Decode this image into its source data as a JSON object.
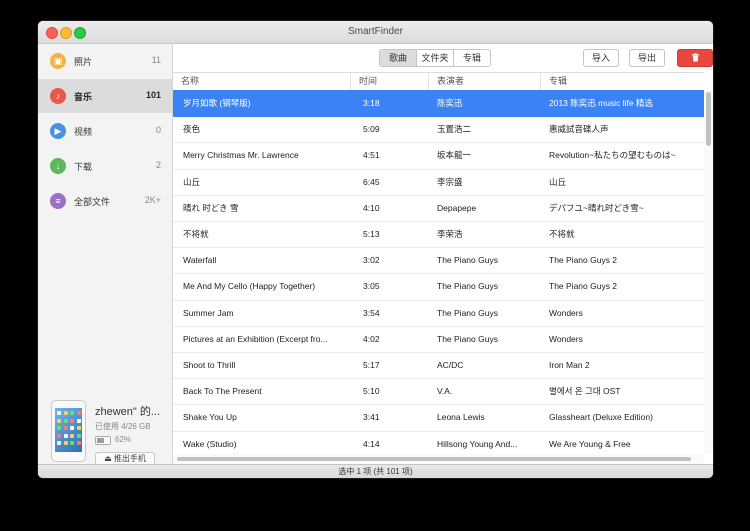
{
  "window": {
    "title": "SmartFinder"
  },
  "sidebar": {
    "items": [
      {
        "label": "照片",
        "count": "11",
        "icon": "photo-icon",
        "color": "#f5b33c",
        "glyph": "▣"
      },
      {
        "label": "音乐",
        "count": "101",
        "icon": "music-icon",
        "color": "#e8574c",
        "glyph": "♪",
        "active": true
      },
      {
        "label": "视频",
        "count": "0",
        "icon": "video-icon",
        "color": "#4a90e2",
        "glyph": "▶"
      },
      {
        "label": "下载",
        "count": "2",
        "icon": "download-icon",
        "color": "#5cb85c",
        "glyph": "↓"
      },
      {
        "label": "全部文件",
        "count": "2K+",
        "icon": "all-files-icon",
        "color": "#9b6fc7",
        "glyph": "≡"
      }
    ],
    "device": {
      "name": "zhewen\" 的...",
      "used": "已使用 4/26 GB",
      "battery": "62%",
      "battery_level": 0.62,
      "eject_label": "推出手机"
    }
  },
  "toolbar": {
    "tabs": [
      "歌曲",
      "文件夹",
      "专辑"
    ],
    "import_label": "导入",
    "export_label": "导出",
    "delete_icon": "trash-icon"
  },
  "table": {
    "columns": [
      "名称",
      "时间",
      "表演者",
      "专辑"
    ],
    "rows": [
      [
        "岁月如歌 (钢琴版)",
        "3:18",
        "陈奕迅",
        "2013 陈奕迅 music life 精选"
      ],
      [
        "夜色",
        "5:09",
        "玉置浩二",
        "惠威試音碟人声"
      ],
      [
        "Merry Christmas Mr. Lawrence",
        "4:51",
        "坂本龍一",
        "Revolution~私たちの望むものは~"
      ],
      [
        "山丘",
        "6:45",
        "李宗盛",
        "山丘"
      ],
      [
        "晴れ 时どき 雪",
        "4:10",
        "Depapepe",
        "デパフユ~晴れ时どき雪~"
      ],
      [
        "不将就",
        "5:13",
        "李荣浩",
        "不将就"
      ],
      [
        "Waterfall",
        "3:02",
        "The Piano Guys",
        "The Piano Guys 2"
      ],
      [
        "Me And My Cello (Happy Together)",
        "3:05",
        "The Piano Guys",
        "The Piano Guys 2"
      ],
      [
        "Summer Jam",
        "3:54",
        "The Piano Guys",
        "Wonders"
      ],
      [
        "Pictures at an Exhibition (Excerpt fro...",
        "4:02",
        "The Piano Guys",
        "Wonders"
      ],
      [
        "Shoot to Thrill",
        "5:17",
        "AC/DC",
        "Iron Man 2"
      ],
      [
        "Back To The Present",
        "5:10",
        "V.A.",
        "별에서 온 그대 OST"
      ],
      [
        "Shake You Up",
        "3:41",
        "Leona Lewis",
        "Glassheart (Deluxe Edition)"
      ],
      [
        "Wake (Studio)",
        "4:14",
        "Hillsong Young And...",
        "We Are Young & Free"
      ]
    ],
    "selected_index": 0
  },
  "status": {
    "text": "选中 1 项 (共 101 项)"
  },
  "colors": {
    "selection": "#3a82f6",
    "delete": "#e9473f"
  }
}
